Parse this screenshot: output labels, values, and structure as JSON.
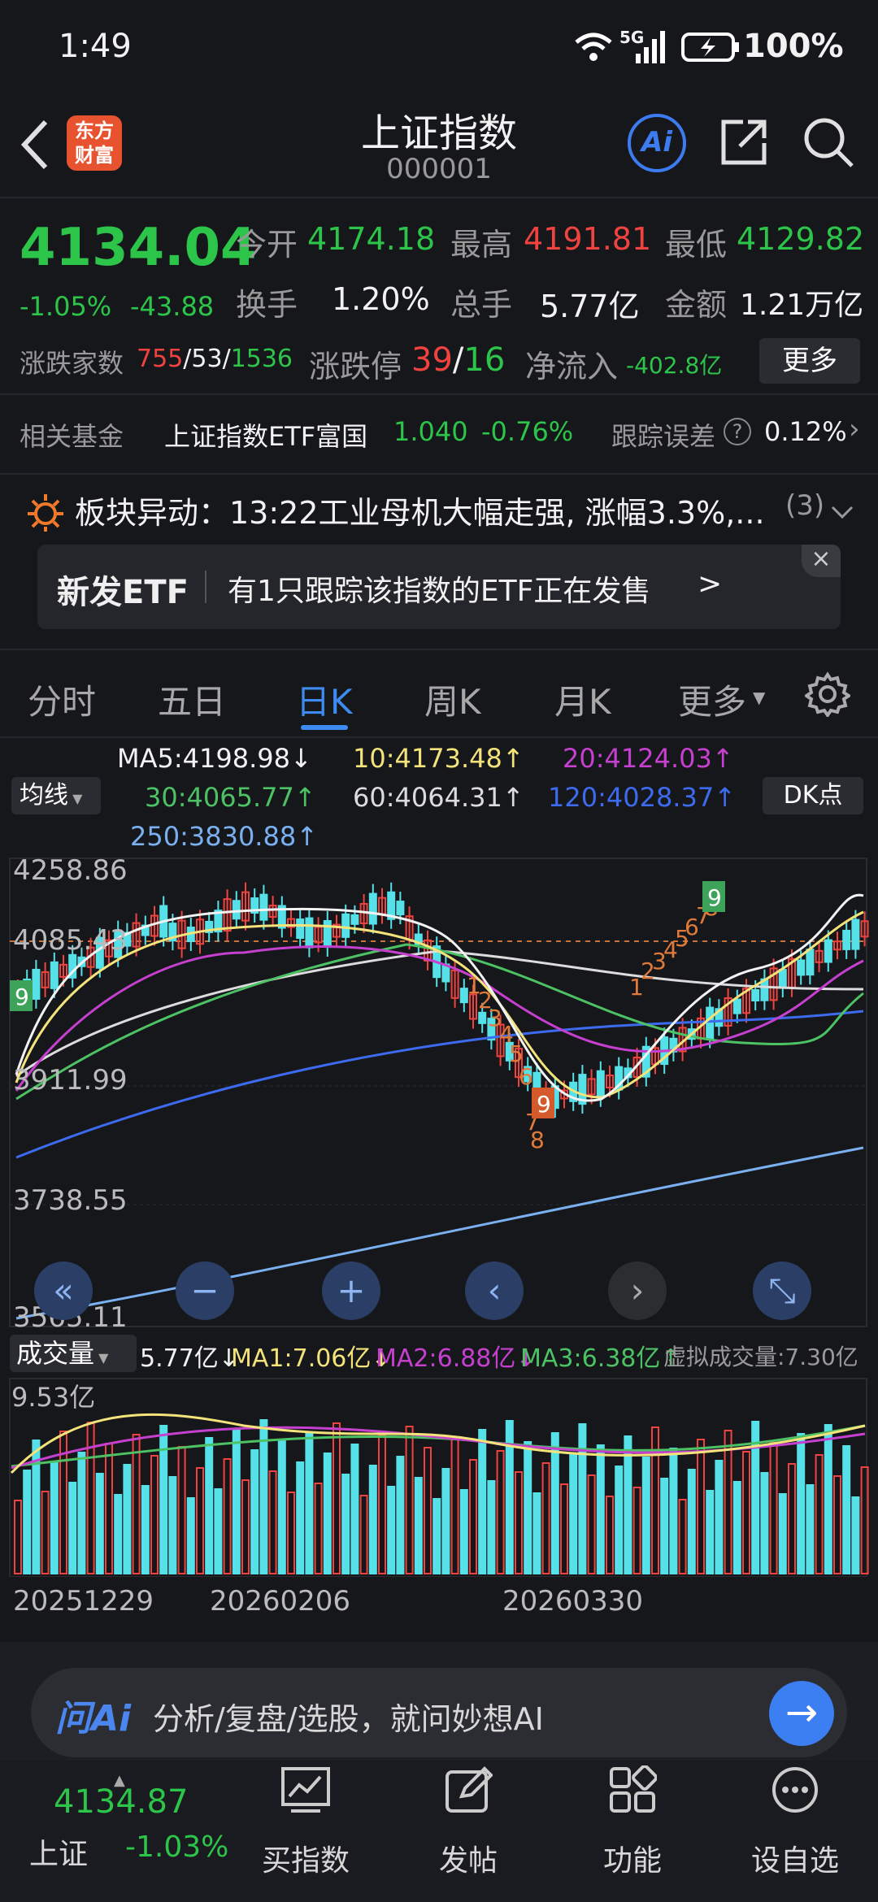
{
  "status": {
    "time": "1:49",
    "network": "5G",
    "battery": "100%"
  },
  "header": {
    "title": "上证指数",
    "code": "000001",
    "logo_text": "东方财富",
    "ai_label": "Ai"
  },
  "quote": {
    "price": "4134.04",
    "change_pct": "-1.05%",
    "change": "-43.88",
    "open_label": "今开",
    "open": "4174.18",
    "high_label": "最高",
    "high": "4191.81",
    "low_label": "最低",
    "low": "4129.82",
    "turnover_label": "换手",
    "turnover": "1.20%",
    "volume_label": "总手",
    "volume": "5.77亿",
    "amount_label": "金额",
    "amount": "1.21万亿",
    "breadth_label": "涨跌家数",
    "breadth_up": "755",
    "breadth_flat": "53",
    "breadth_down": "1536",
    "limit_label": "涨跌停",
    "limit_up": "39",
    "limit_down": "16",
    "inflow_label": "净流入",
    "inflow": "-402.8亿",
    "more_button": "更多"
  },
  "fund": {
    "label": "相关基金",
    "name": "上证指数ETF富国",
    "price": "1.040",
    "change": "-0.76%",
    "tracking_label": "跟踪误差",
    "tracking": "0.12%"
  },
  "alert": {
    "text": "板块异动：13:22工业母机大幅走强, 涨幅3.3%,...",
    "count": "(3)"
  },
  "banner": {
    "tag": "新发ETF",
    "text": "有1只跟踪该指数的ETF正在发售",
    "arrow": ">"
  },
  "tabs": [
    "分时",
    "五日",
    "日K",
    "周K",
    "月K",
    "更多"
  ],
  "active_tab": "日K",
  "ma_panel": {
    "selector": "均线",
    "dk": "DK点",
    "ma5": "MA5:4198.98↓",
    "ma10": "10:4173.48↑",
    "ma20": "20:4124.03↑",
    "ma30": "30:4065.77↑",
    "ma60": "60:4064.31↑",
    "ma120": "120:4028.37↑",
    "ma250": "250:3830.88↑"
  },
  "volume_panel": {
    "selector": "成交量",
    "vol": "5.77亿↓",
    "ma1": "MA1:7.06亿↓",
    "ma2": "MA2:6.88亿↓",
    "ma3": "MA3:6.38亿↑",
    "virtual": "虚拟成交量:7.30亿",
    "max_label": "9.53亿"
  },
  "chart_data": {
    "type": "candlestick",
    "y_ticks": [
      "4258.86",
      "4085.43",
      "3911.99",
      "3738.55",
      "3565.11"
    ],
    "ylim": [
      3565.11,
      4258.86
    ],
    "x_ticks": [
      "20251229",
      "20260206",
      "20260330"
    ],
    "td_marks": [
      "9",
      "1",
      "2",
      "3",
      "4",
      "5",
      "6",
      "7",
      "8",
      "9",
      "1",
      "2",
      "3",
      "4",
      "5",
      "6",
      "7",
      "8",
      "9"
    ],
    "last_price_line": 4134.04
  },
  "ask_ai": {
    "brand": "问Ai",
    "placeholder": "分析/复盘/选股，就问妙想AI"
  },
  "bottom_nav": {
    "index_name": "上证",
    "index_price": "4134.87",
    "index_change": "-1.03%",
    "items": [
      "买指数",
      "发帖",
      "功能",
      "设自选"
    ]
  }
}
